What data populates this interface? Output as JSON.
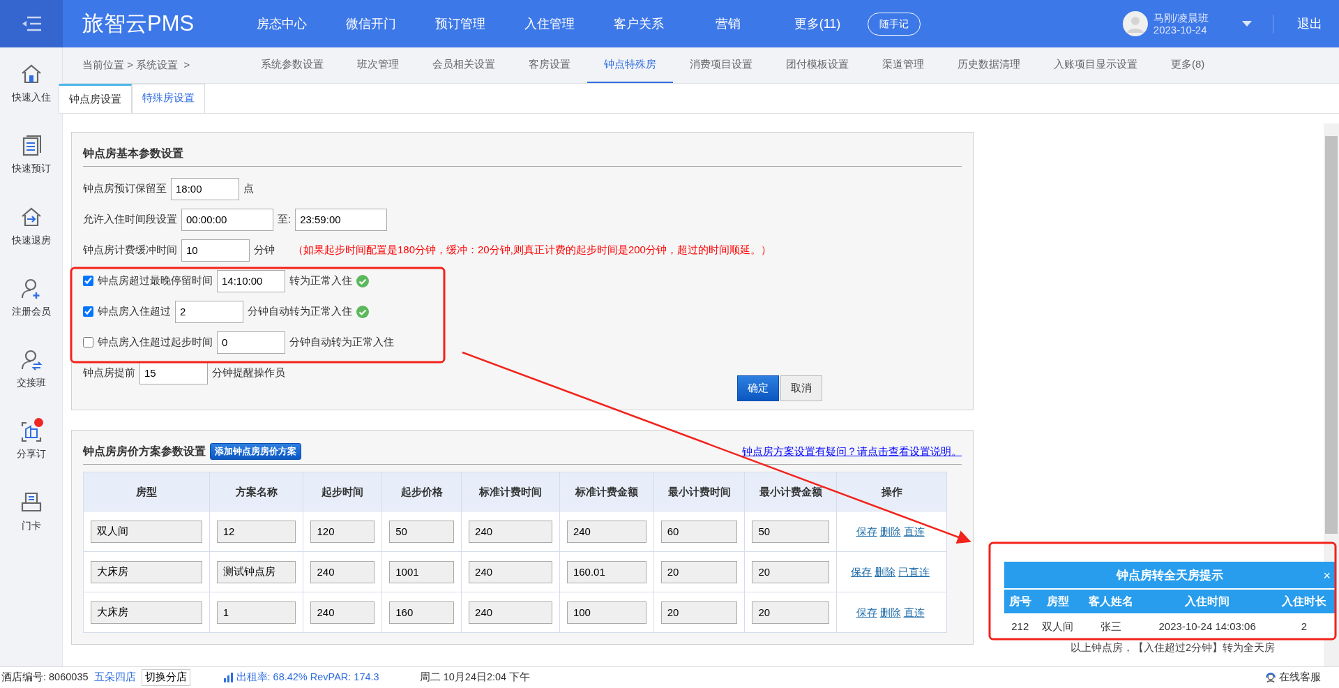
{
  "app": {
    "logo": "旅智云PMS"
  },
  "top_nav": [
    {
      "label": "房态中心"
    },
    {
      "label": "微信开门"
    },
    {
      "label": "预订管理"
    },
    {
      "label": "入住管理"
    },
    {
      "label": "客户关系"
    },
    {
      "label": "营销"
    },
    {
      "label": "更多(11)"
    }
  ],
  "quick_note_button": "随手记",
  "user": {
    "name": "马刚/凌晨班",
    "date": "2023-10-24"
  },
  "logout": "退出",
  "sidebar": {
    "items": [
      {
        "label": "快速入住",
        "kind": "home",
        "notification": false
      },
      {
        "label": "快速预订",
        "kind": "list",
        "notification": false
      },
      {
        "label": "快速退房",
        "kind": "checkout",
        "notification": false
      },
      {
        "label": "注册会员",
        "kind": "useradd",
        "notification": false
      },
      {
        "label": "交接班",
        "kind": "userswap",
        "notification": false
      },
      {
        "label": "分享订",
        "kind": "scan",
        "notification": true
      },
      {
        "label": "门卡",
        "kind": "card",
        "notification": false
      }
    ]
  },
  "breadcrumb": "当前位置 > 系统设置  >",
  "sub_nav": [
    {
      "label": "系统参数设置",
      "selected": false
    },
    {
      "label": "班次管理",
      "selected": false
    },
    {
      "label": "会员相关设置",
      "selected": false
    },
    {
      "label": "客房设置",
      "selected": false
    },
    {
      "label": "钟点特殊房",
      "selected": true
    },
    {
      "label": "消费项目设置",
      "selected": false
    },
    {
      "label": "团付模板设置",
      "selected": false
    },
    {
      "label": "渠道管理",
      "selected": false
    },
    {
      "label": "历史数据清理",
      "selected": false
    },
    {
      "label": "入账项目显示设置",
      "selected": false
    },
    {
      "label": "更多(8)",
      "selected": false
    }
  ],
  "tabs": [
    {
      "label": "钟点房设置",
      "selected": true
    },
    {
      "label": "特殊房设置",
      "selected": false
    }
  ],
  "basic_settings": {
    "title": "钟点房基本参数设置",
    "rows": [
      {
        "items": [
          {
            "kind": "text",
            "text": "钟点房预订保留至"
          },
          {
            "kind": "input",
            "value": "18:00"
          },
          {
            "kind": "text",
            "text": "点"
          }
        ]
      },
      {
        "items": [
          {
            "kind": "text",
            "text": "允许入住时间段设置"
          },
          {
            "kind": "range",
            "value": "00:00:00"
          },
          {
            "kind": "text",
            "text": "至:"
          },
          {
            "kind": "range",
            "value": "23:59:00"
          }
        ]
      },
      {
        "items": [
          {
            "kind": "text",
            "text": "钟点房计费缓冲时间"
          },
          {
            "kind": "input",
            "value": "10"
          },
          {
            "kind": "text",
            "text": "分钟"
          },
          {
            "kind": "note",
            "text": "（如果起步时间配置是180分钟，缓冲：20分钟,则真正计费的起步时间是200分钟，超过的时间顺延。）"
          }
        ]
      },
      {
        "items": [
          {
            "kind": "check",
            "checked": true,
            "text": "钟点房超过最晚停留时间"
          },
          {
            "kind": "input",
            "value": "14:10:00"
          },
          {
            "kind": "text",
            "text": "转为正常入住"
          },
          {
            "kind": "ok"
          }
        ]
      },
      {
        "items": [
          {
            "kind": "check",
            "checked": true,
            "text": "钟点房入住超过"
          },
          {
            "kind": "input",
            "value": "2"
          },
          {
            "kind": "text",
            "text": "分钟自动转为正常入住"
          },
          {
            "kind": "ok"
          }
        ]
      },
      {
        "items": [
          {
            "kind": "check",
            "checked": false,
            "text": "钟点房入住超过起步时间"
          },
          {
            "kind": "input",
            "value": "0"
          },
          {
            "kind": "text",
            "text": "分钟自动转为正常入住"
          }
        ]
      },
      {
        "items": [
          {
            "kind": "text",
            "text": "钟点房提前"
          },
          {
            "kind": "input",
            "value": "15"
          },
          {
            "kind": "text",
            "text": "分钟提醒操作员"
          }
        ]
      }
    ],
    "buttons": [
      {
        "label": "确定",
        "kind": "primary"
      },
      {
        "label": "取消",
        "kind": "secondary"
      }
    ]
  },
  "price_plans": {
    "title": "钟点房房价方案参数设置",
    "add_button": "添加钟点房房价方案",
    "help_link": "钟点房方案设置有疑问？请点击查看设置说明。",
    "columns": [
      "房型",
      "方案名称",
      "起步时间",
      "起步价格",
      "标准计费时间",
      "标准计费金额",
      "最小计费时间",
      "最小计费金额",
      "操作"
    ],
    "rows": [
      {
        "cells": [
          "双人间",
          "12",
          "120",
          "50",
          "240",
          "240",
          "60",
          "50"
        ],
        "actions": [
          "保存",
          "删除",
          "直连"
        ]
      },
      {
        "cells": [
          "大床房",
          "测试钟点房",
          "240",
          "1001",
          "240",
          "160.01",
          "20",
          "20"
        ],
        "actions": [
          "保存",
          "删除",
          "已直连"
        ]
      },
      {
        "cells": [
          "大床房",
          "1",
          "240",
          "160",
          "240",
          "100",
          "20",
          "20"
        ],
        "actions": [
          "保存",
          "删除",
          "直连"
        ]
      }
    ]
  },
  "popup": {
    "title": "钟点房转全天房提示",
    "close": "×",
    "columns": [
      "房号",
      "房型",
      "客人姓名",
      "入住时间",
      "入住时长"
    ],
    "rows": [
      [
        "212",
        "双人间",
        "张三",
        "2023-10-24 14:03:06",
        "2"
      ]
    ],
    "caption": "以上钟点房，【入住超过2分钟】转为全天房"
  },
  "status_bar": {
    "hotel_label": "酒店编号: 8060035",
    "hotel_name": "五朵四店",
    "switch_button": "切换分店",
    "occupancy": "出租率: 68.42% RevPAR: 174.3",
    "datetime": "周二 10月24日2:04 下午",
    "support": "在线客服"
  }
}
